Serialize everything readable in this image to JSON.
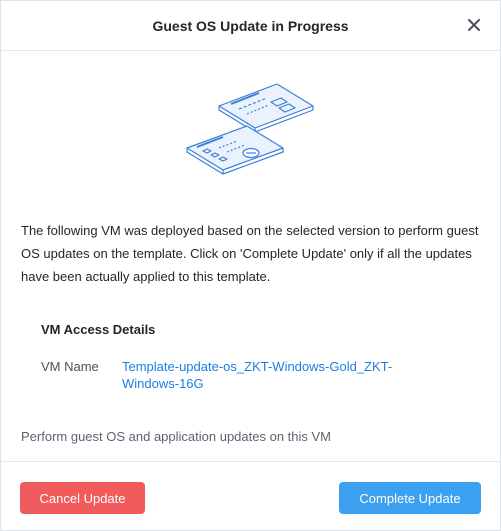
{
  "dialog": {
    "title": "Guest OS Update in Progress",
    "close_icon": "close-icon"
  },
  "illustration": {
    "icon": "documents-illustration-icon"
  },
  "description": "The following VM was deployed based on the selected version to perform guest OS updates on the template. Click on 'Complete Update' only if all the updates have been actually applied to this template.",
  "access_details": {
    "section_title": "VM Access Details",
    "vm_name_label": "VM Name",
    "vm_name_value": "Template-update-os_ZKT-Windows-Gold_ZKT-Windows-16G"
  },
  "footnote": "Perform guest OS and application updates on this VM",
  "buttons": {
    "cancel_label": "Cancel Update",
    "complete_label": "Complete Update"
  },
  "colors": {
    "link": "#1b7fe3",
    "cancel": "#f15b5b",
    "primary": "#3aa0ef",
    "illustration": "#3d7fd8"
  }
}
